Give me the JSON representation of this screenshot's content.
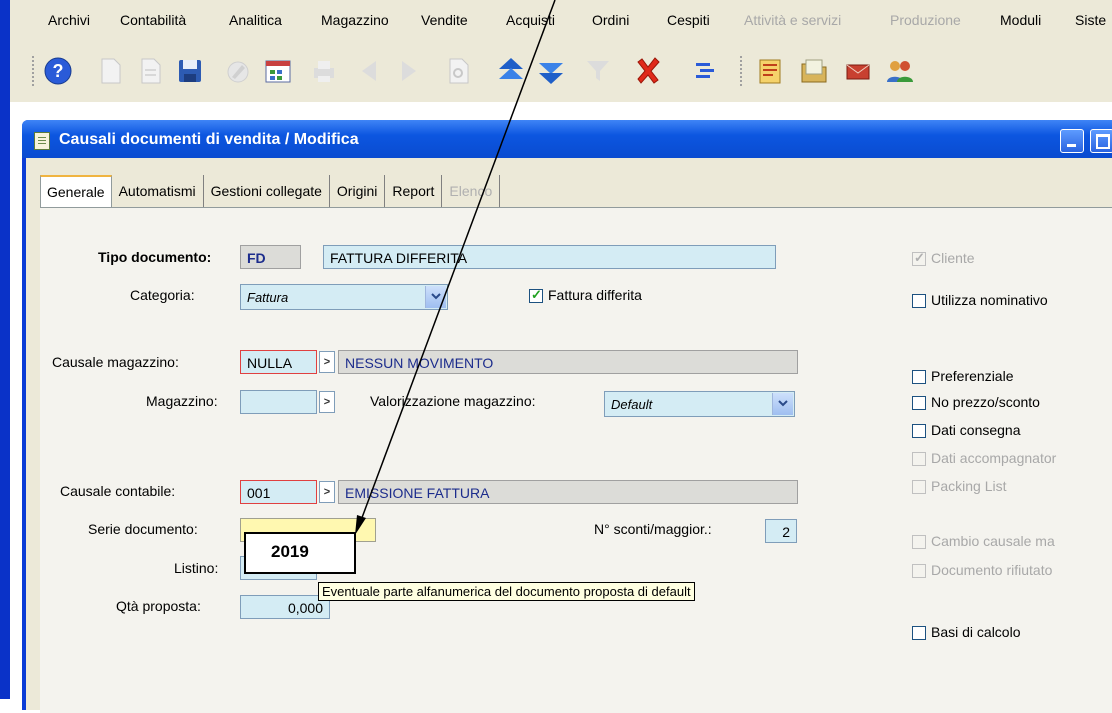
{
  "menu": {
    "items": [
      {
        "label": "Archivi",
        "disabled": false
      },
      {
        "label": "Contabilità",
        "disabled": false
      },
      {
        "label": "Analitica",
        "disabled": false
      },
      {
        "label": "Magazzino",
        "disabled": false
      },
      {
        "label": "Vendite",
        "disabled": false
      },
      {
        "label": "Acquisti",
        "disabled": false
      },
      {
        "label": "Ordini",
        "disabled": false
      },
      {
        "label": "Cespiti",
        "disabled": false
      },
      {
        "label": "Attività e servizi",
        "disabled": true
      },
      {
        "label": "Produzione",
        "disabled": true
      },
      {
        "label": "Moduli",
        "disabled": false
      },
      {
        "label": "Siste",
        "disabled": false
      }
    ]
  },
  "toolbar": {
    "icons": [
      "help-icon",
      "new-document-icon",
      "copy-document-icon",
      "save-icon",
      "edit-icon",
      "calendar-icon",
      "print-icon",
      "previous-icon",
      "next-icon",
      "search-icon",
      "first-record-icon",
      "last-record-icon",
      "filter-icon",
      "delete-icon",
      "tree-icon",
      "notes-icon",
      "folder-icon",
      "mail-icon",
      "users-icon"
    ]
  },
  "window": {
    "title": "Causali documenti di vendita / Modifica"
  },
  "tabs": [
    {
      "label": "Generale",
      "active": true,
      "disabled": false
    },
    {
      "label": "Automatismi",
      "active": false,
      "disabled": false
    },
    {
      "label": "Gestioni collegate",
      "active": false,
      "disabled": false
    },
    {
      "label": "Origini",
      "active": false,
      "disabled": false
    },
    {
      "label": "Report",
      "active": false,
      "disabled": false
    },
    {
      "label": "Elenco",
      "active": false,
      "disabled": true
    }
  ],
  "form": {
    "tipo_documento": {
      "label": "Tipo documento:",
      "code": "FD",
      "description": "FATTURA DIFFERITA"
    },
    "categoria": {
      "label": "Categoria:",
      "value": "Fattura"
    },
    "fattura_differita": {
      "label": "Fattura differita",
      "checked": true
    },
    "causale_magazzino": {
      "label": "Causale magazzino:",
      "code": "NULLA",
      "description": "NESSUN MOVIMENTO"
    },
    "magazzino": {
      "label": "Magazzino:",
      "value": ""
    },
    "valorizzazione": {
      "label": "Valorizzazione magazzino:",
      "value": "Default"
    },
    "causale_contabile": {
      "label": "Causale contabile:",
      "code": "001",
      "description": "EMISSIONE FATTURA"
    },
    "serie_documento": {
      "label": "Serie documento:",
      "value": ""
    },
    "sconti": {
      "label": "N° sconti/maggior.:",
      "value": "2"
    },
    "listino": {
      "label": "Listino:",
      "value": ""
    },
    "qta_proposta": {
      "label": "Qtà proposta:",
      "value": "0,000"
    }
  },
  "checkboxes": {
    "cliente": {
      "label": "Cliente",
      "checked": true,
      "disabled": true
    },
    "utilizza_nominativo": {
      "label": "Utilizza nominativo",
      "checked": false,
      "disabled": false
    },
    "preferenziale": {
      "label": "Preferenziale",
      "checked": false,
      "disabled": false
    },
    "no_prezzo": {
      "label": "No prezzo/sconto",
      "checked": false,
      "disabled": false
    },
    "dati_consegna": {
      "label": "Dati consegna",
      "checked": false,
      "disabled": false
    },
    "dati_accompagnatori": {
      "label": "Dati accompagnator",
      "checked": false,
      "disabled": true
    },
    "packing_list": {
      "label": "Packing List",
      "checked": false,
      "disabled": true
    },
    "cambio_causale": {
      "label": "Cambio causale ma",
      "checked": false,
      "disabled": true
    },
    "documento_rifiutato": {
      "label": "Documento rifiutato",
      "checked": false,
      "disabled": true
    },
    "basi_calcolo": {
      "label": "Basi di calcolo",
      "checked": false,
      "disabled": false
    }
  },
  "tooltip": "Eventuale parte alfanumerica del documento proposta di default",
  "callout": "2019"
}
